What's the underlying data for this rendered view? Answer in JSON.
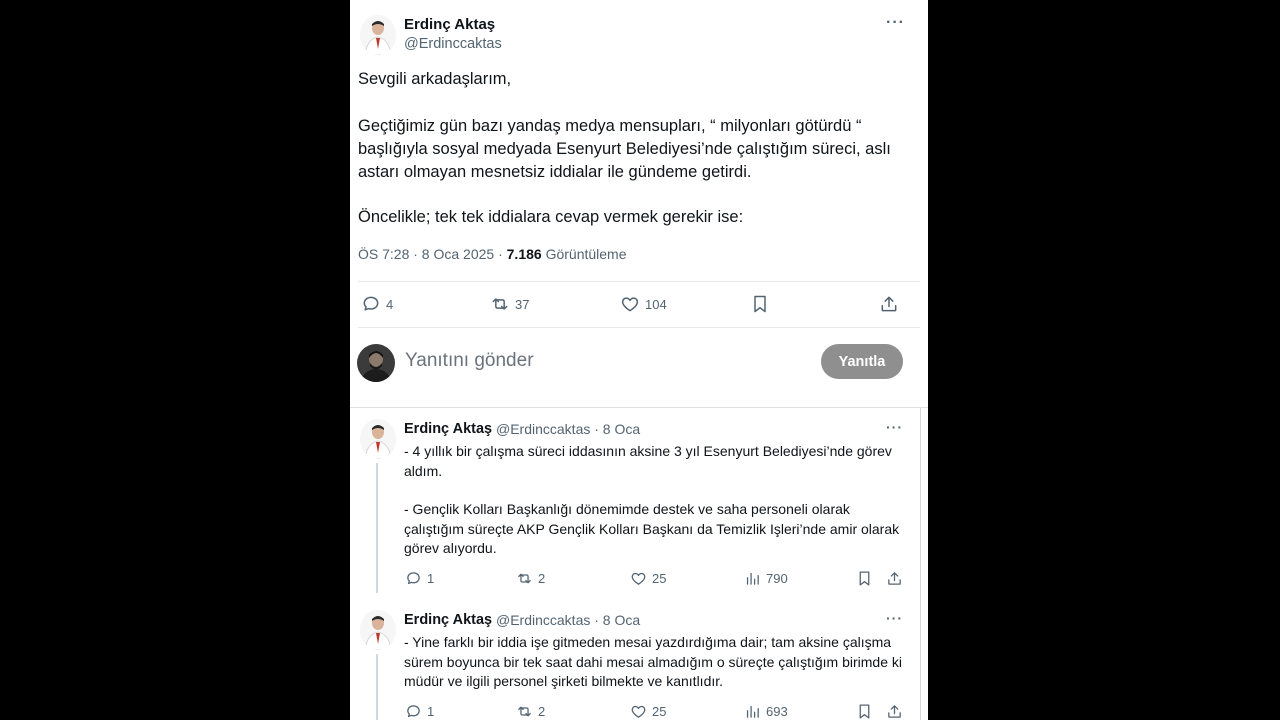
{
  "main_tweet": {
    "author_name": "Erdinç Aktaş",
    "author_handle": "@Erdinccaktas",
    "more": "···",
    "paragraphs": [
      "Sevgili arkadaşlarım,",
      "Geçtiğimiz gün bazı yandaş medya mensupları, “ milyonları götürdü “ başlığıyla sosyal medyada Esenyurt Belediyesi’nde çalıştığım süreci, aslı astarı olmayan mesnetsiz iddialar ile gündeme getirdi.",
      "Öncelikle; tek tek iddialara cevap vermek gerekir ise:"
    ],
    "timestamp": "ÖS 7:28 · 8 Oca 2025 · ",
    "views_count": "7.186",
    "views_label": " Görüntüleme",
    "replies": "4",
    "retweets": "37",
    "likes": "104"
  },
  "reply_box": {
    "placeholder": "Yanıtını gönder",
    "button": "Yanıtla"
  },
  "replies": [
    {
      "author_name": "Erdinç Aktaş",
      "handle_date": "@Erdinccaktas · 8 Oca",
      "more": "···",
      "paragraphs": [
        "- 4 yıllık bir çalışma süreci iddasının aksine 3 yıl Esenyurt Belediyesi’nde görev aldım.",
        "- Gençlik Kolları Başkanlığı dönemimde destek ve saha personeli olarak çalıştığım süreçte AKP Gençlik Kolları Başkanı da Temizlik Işleri’nde amir olarak görev alıyordu."
      ],
      "replies": "1",
      "retweets": "2",
      "likes": "25",
      "views": "790"
    },
    {
      "author_name": "Erdinç Aktaş",
      "handle_date": "@Erdinccaktas · 8 Oca",
      "more": "···",
      "paragraphs": [
        "- Yine farklı bir iddia işe gitmeden mesai yazdırdığıma dair; tam aksine çalışma sürem boyunca bir tek saat dahi mesai almadığım o süreçte çalıştığım birimde ki müdür ve ilgili personel şirketi bilmekte ve kanıtlıdır."
      ],
      "replies": "1",
      "retweets": "2",
      "likes": "25",
      "views": "693"
    }
  ]
}
